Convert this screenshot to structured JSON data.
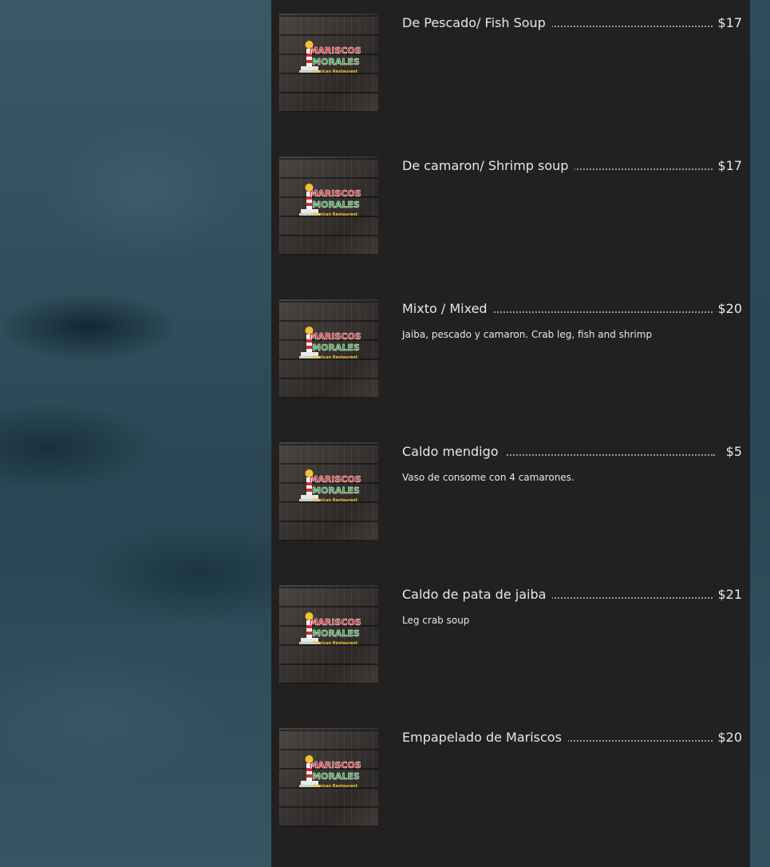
{
  "logo": {
    "line1": "MARISCOS",
    "line2": "MORALES",
    "line3": "Mexican Restaurant"
  },
  "menu_items": [
    {
      "name": "De Pescado/ Fish Soup",
      "price": "$17",
      "description": ""
    },
    {
      "name": "De camaron/ Shrimp soup",
      "price": "$17",
      "description": ""
    },
    {
      "name": "Mixto / Mixed",
      "price": "$20",
      "description": "Jaiba, pescado y camaron. Crab leg, fish and shrimp"
    },
    {
      "name": "Caldo mendigo",
      "price": "$5",
      "description": "Vaso de consome con 4 camarones."
    },
    {
      "name": "Caldo de pata de jaiba",
      "price": "$21",
      "description": "Leg crab soup"
    },
    {
      "name": "Empapelado de Mariscos",
      "price": "$20",
      "description": ""
    }
  ],
  "colors": {
    "panel_bg": "#212121",
    "page_bg": "#2e4a58",
    "text": "#e8e8e8",
    "logo_red": "#d9282f",
    "logo_green": "#2f9a3a",
    "logo_yellow": "#f2c230"
  }
}
